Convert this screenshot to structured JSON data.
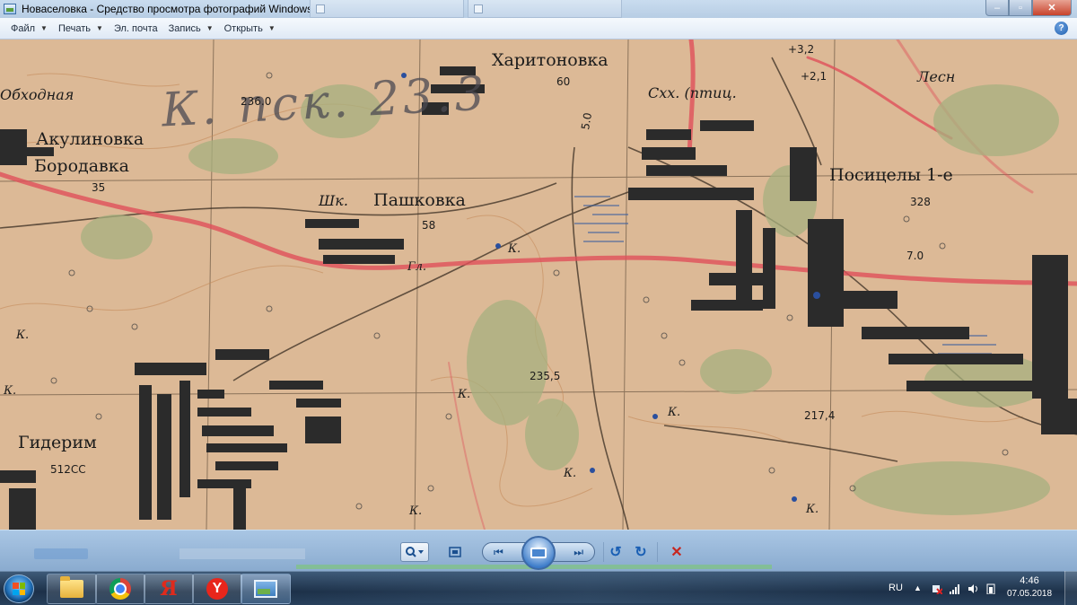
{
  "window": {
    "title": "Новаселовка - Средство просмотра фотографий Windows",
    "controls": {
      "minimize": "–",
      "maximize": "▫",
      "close": "✕"
    }
  },
  "menu": {
    "items": [
      {
        "label": "Файл",
        "has_dropdown": true
      },
      {
        "label": "Печать",
        "has_dropdown": true
      },
      {
        "label": "Эл. почта",
        "has_dropdown": false
      },
      {
        "label": "Запись",
        "has_dropdown": true
      },
      {
        "label": "Открыть",
        "has_dropdown": true
      }
    ],
    "dropdown_glyph": "▼",
    "help_glyph": "?"
  },
  "map": {
    "handwritten_note": "К. пск. 23.3",
    "labels": {
      "obkhodnaya": "Обходная",
      "akulinovka": "Акулиновка",
      "borodavka": "Бородавка",
      "elev_35": "35",
      "elev_2360": "236.0",
      "kharitonovka": "Харитоновка",
      "elev_60": "60",
      "skh": "Схх. (птиц.",
      "elev_32": "+3,2",
      "elev_21": "+2,1",
      "lesn": "Лесн",
      "shk": "Шк.",
      "pashkovka": "Пашковка",
      "elev_58": "58",
      "gl": "Гл.",
      "k1": "К.",
      "posicely": "Посицелы 1-е",
      "elev_328": "328",
      "elev_70": "7.0",
      "elev_50": "5.0",
      "k2": "К.",
      "elev_2355": "235,5",
      "k3": "К.",
      "k4": "К.",
      "elev_2174": "217,4",
      "gyderim": "Гидерим",
      "elev_512cc": "512СС",
      "k5": "К.",
      "k6": "К.",
      "k7": "К.",
      "k8": "К."
    }
  },
  "controls": {
    "zoom_icon": "magnifier-icon",
    "fit_icon": "fit-window-icon",
    "prev_icon": "⏮",
    "next_icon": "⏭",
    "rotate_ccw": "↺",
    "rotate_cw": "↻",
    "delete": "✕"
  },
  "taskbar": {
    "apps": [
      "file-explorer",
      "chrome",
      "yandex",
      "yandex-browser",
      "photo-viewer"
    ],
    "yandex_glyph": "Я",
    "yandex_browser_glyph": "Y",
    "lang": "RU",
    "tray_arrow": "▲",
    "time": "4:46",
    "date": "07.05.2018"
  },
  "colors": {
    "map_paper": "#dcb996",
    "town_fill": "#2b2b2b",
    "forest": "#a7b07f",
    "red_line": "#e0505a",
    "water": "#3a5f9e"
  }
}
